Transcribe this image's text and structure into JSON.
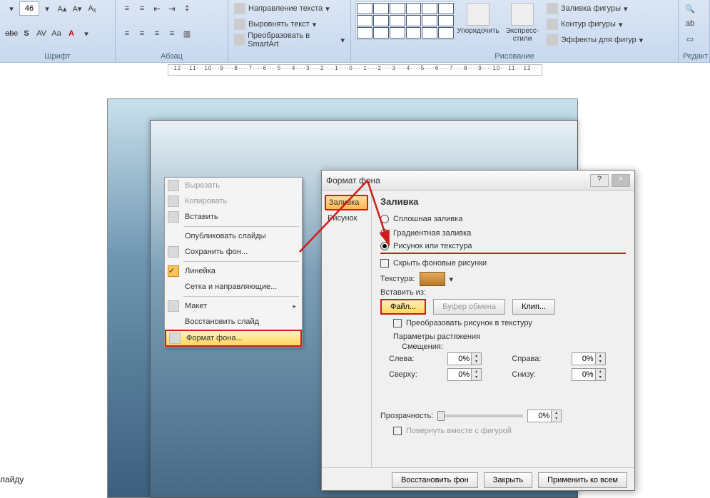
{
  "ribbon": {
    "font": {
      "size": "46",
      "label": "Шрифт"
    },
    "paragraph": {
      "label": "Абзац"
    },
    "direction": "Направление текста",
    "align": "Выровнять текст",
    "smartart": "Преобразовать в SmartArt",
    "drawing": {
      "arrange": "Упорядочить",
      "express": "Экспресс-стили",
      "fill": "Заливка фигуры",
      "outline": "Контур фигуры",
      "effects": "Эффекты для фигур",
      "label": "Рисование"
    },
    "edit": {
      "label": "Редакт"
    }
  },
  "ruler": "-12···11···10···9····8····7····6····5····4····3····2····1····0····1····2····3····4····5····6····7····8····9····10···11···12···",
  "context": {
    "cut": "Вырезать",
    "copy": "Копировать",
    "paste": "Вставить",
    "publish": "Опубликовать слайды",
    "saveBg": "Сохранить фон...",
    "ruler": "Линейка",
    "grid": "Сетка и направляющие...",
    "layout": "Макет",
    "restore": "Восстановить слайд",
    "format": "Формат фона..."
  },
  "dlg": {
    "title": "Формат фона",
    "help": "?",
    "close": "×",
    "tabs": {
      "fill": "Заливка",
      "picture": "Рисунок"
    },
    "heading": "Заливка",
    "radios": {
      "solid": "Сплошная заливка",
      "gradient": "Градиентная заливка",
      "picture": "Рисунок или текстура"
    },
    "hideBg": "Скрыть фоновые рисунки",
    "texture": "Текстура:",
    "insertFrom": "Вставить из:",
    "file": "Файл...",
    "clipboard": "Буфер обмена",
    "clip": "Клип...",
    "toTexture": "Преобразовать рисунок в текстуру",
    "stretch": "Параметры растяжения",
    "offsets": "Смещения:",
    "left": "Слева:",
    "right": "Справа:",
    "top": "Сверху:",
    "bottom": "Снизу:",
    "pct": "0%",
    "transparency": "Прозрачность:",
    "rotate": "Повернуть вместе с фигурой",
    "restoreBg": "Восстановить фон",
    "closeBtn": "Закрыть",
    "applyAll": "Применить ко всем"
  },
  "footer": "лайду"
}
